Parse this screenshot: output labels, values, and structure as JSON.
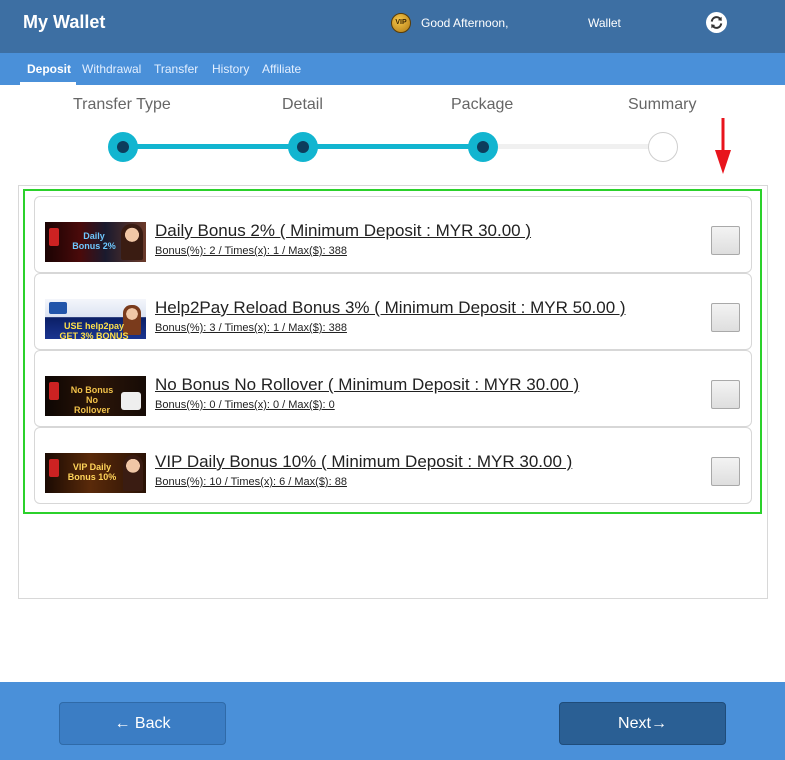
{
  "header": {
    "title": "My Wallet",
    "vip_badge": "VIP",
    "greeting": "Good Afternoon,",
    "wallet_label": "Wallet",
    "refresh_icon": "refresh-icon"
  },
  "subnav": {
    "items": [
      {
        "label": "Deposit",
        "active": true
      },
      {
        "label": "Withdrawal",
        "active": false
      },
      {
        "label": "Transfer",
        "active": false
      },
      {
        "label": "History",
        "active": false
      },
      {
        "label": "Affiliate",
        "active": false
      }
    ]
  },
  "stepper": {
    "steps": [
      {
        "label": "Transfer Type",
        "state": "done"
      },
      {
        "label": "Detail",
        "state": "done"
      },
      {
        "label": "Package",
        "state": "current"
      },
      {
        "label": "Summary",
        "state": "todo"
      }
    ],
    "accent_color": "#12b5d0",
    "dot_color": "#0d3d5c"
  },
  "packages": [
    {
      "title": "Daily Bonus 2% ( Minimum Deposit : MYR 30.00 )",
      "details": "Bonus(%): 2 / Times(x): 1 / Max($): 388",
      "banner": "Daily Bonus 2%",
      "checked": false
    },
    {
      "title": "Help2Pay Reload Bonus 3% ( Minimum Deposit : MYR 50.00 )",
      "details": "Bonus(%): 3 / Times(x): 1 / Max($): 388",
      "banner": "USE help2pay GET 3% BONUS",
      "checked": false
    },
    {
      "title": "No Bonus No Rollover ( Minimum Deposit : MYR 30.00 )",
      "details": "Bonus(%): 0 / Times(x): 0 / Max($): 0",
      "banner": "No Bonus No Rollover",
      "checked": false
    },
    {
      "title": "VIP Daily Bonus 10% ( Minimum Deposit : MYR 30.00 )",
      "details": "Bonus(%): 10 / Times(x): 6 / Max($): 88",
      "banner": "VIP Daily Bonus 10%",
      "checked": false
    }
  ],
  "footer": {
    "back_label": "← Back",
    "next_label": "Next→"
  },
  "colors": {
    "topbar": "#3d6fa3",
    "subnav": "#4a90d9",
    "highlight": "#2bd12b",
    "arrow": "#e8141c"
  }
}
